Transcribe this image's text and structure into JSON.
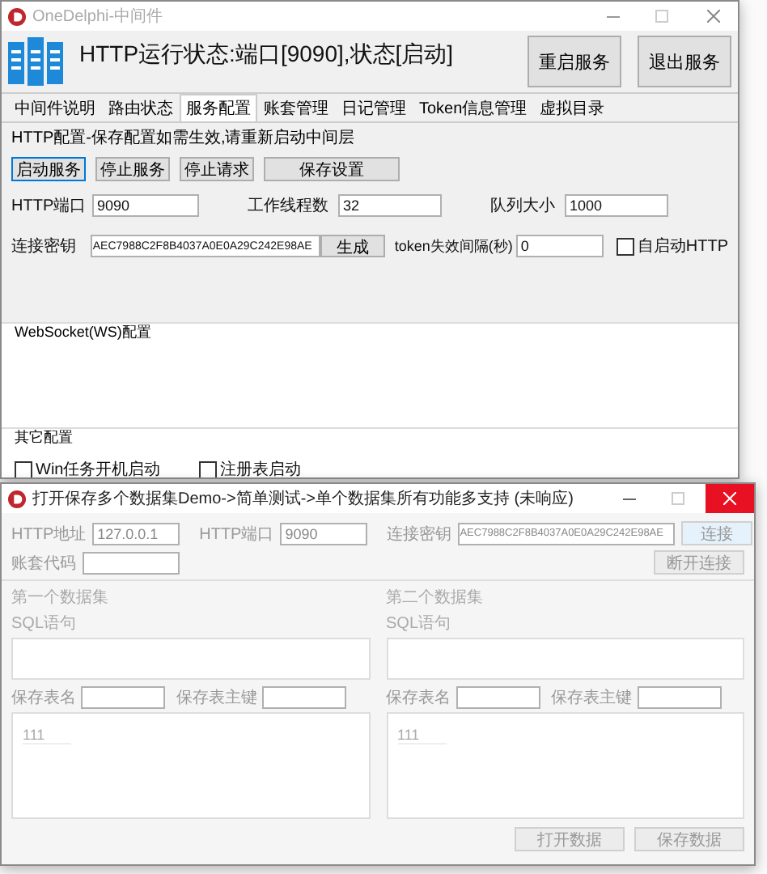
{
  "main_window": {
    "title": "OneDelphi-中间件",
    "status": "HTTP运行状态:端口[9090],状态[启动]",
    "header_buttons": [
      "重启服务",
      "退出服务"
    ],
    "tabs": [
      {
        "label": "中间件说明",
        "selected": false
      },
      {
        "label": "路由状态",
        "selected": false
      },
      {
        "label": "服务配置",
        "selected": true
      },
      {
        "label": "账套管理",
        "selected": false
      },
      {
        "label": "日记管理",
        "selected": false
      },
      {
        "label": "Token信息管理",
        "selected": false
      },
      {
        "label": "虚拟目录",
        "selected": false
      }
    ],
    "note": "HTTP配置-保存配置如需生效,请重新启动中间层",
    "action_buttons": [
      {
        "label": "启动服务",
        "focused": true
      },
      {
        "label": "停止服务",
        "focused": false
      },
      {
        "label": "停止请求",
        "focused": false
      },
      {
        "label": "保存设置",
        "focused": false
      }
    ],
    "port_row": [
      {
        "label": "HTTP端口",
        "value": "9090"
      },
      {
        "label": "工作线程数",
        "value": "32"
      },
      {
        "label": "队列大小",
        "value": "1000"
      }
    ],
    "key_row": {
      "label": "连接密钥",
      "value": "AEC7988C2F8B4037A0E0A29C242E98AE",
      "generate_button": "生成",
      "token_label": "token失效间隔(秒)",
      "token_value": "0",
      "autostart": {
        "label": "自启动HTTP",
        "checked": false
      }
    },
    "websocket_group": {
      "title": "WebSocket(WS)配置"
    },
    "other_group": {
      "title": "其它配置",
      "options": [
        {
          "label": "Win任务开机启动",
          "checked": false
        },
        {
          "label": "注册表启动",
          "checked": false
        }
      ]
    }
  },
  "demo_window": {
    "title": "打开保存多个数据集Demo->简单测试->单个数据集所有功能多支持 (未响应)",
    "connection": [
      {
        "label": "HTTP地址",
        "value": "127.0.0.1"
      },
      {
        "label": "HTTP端口",
        "value": "9090"
      },
      {
        "label": "连接密钥",
        "value": "AEC7988C2F8B4037A0E0A29C242E98AE"
      }
    ],
    "connect_button": "连接",
    "account_label": "账套代码",
    "disconnect_button": "断开连接",
    "datasets": [
      {
        "title": "第一个数据集",
        "sql_label": "SQL语句",
        "table_label": "保存表名",
        "key_label": "保存表主键",
        "grid_header": "111"
      },
      {
        "title": "第二个数据集",
        "sql_label": "SQL语句",
        "table_label": "保存表名",
        "key_label": "保存表主键",
        "grid_header": "111"
      }
    ],
    "footer_buttons": [
      "打开数据",
      "保存数据"
    ]
  }
}
